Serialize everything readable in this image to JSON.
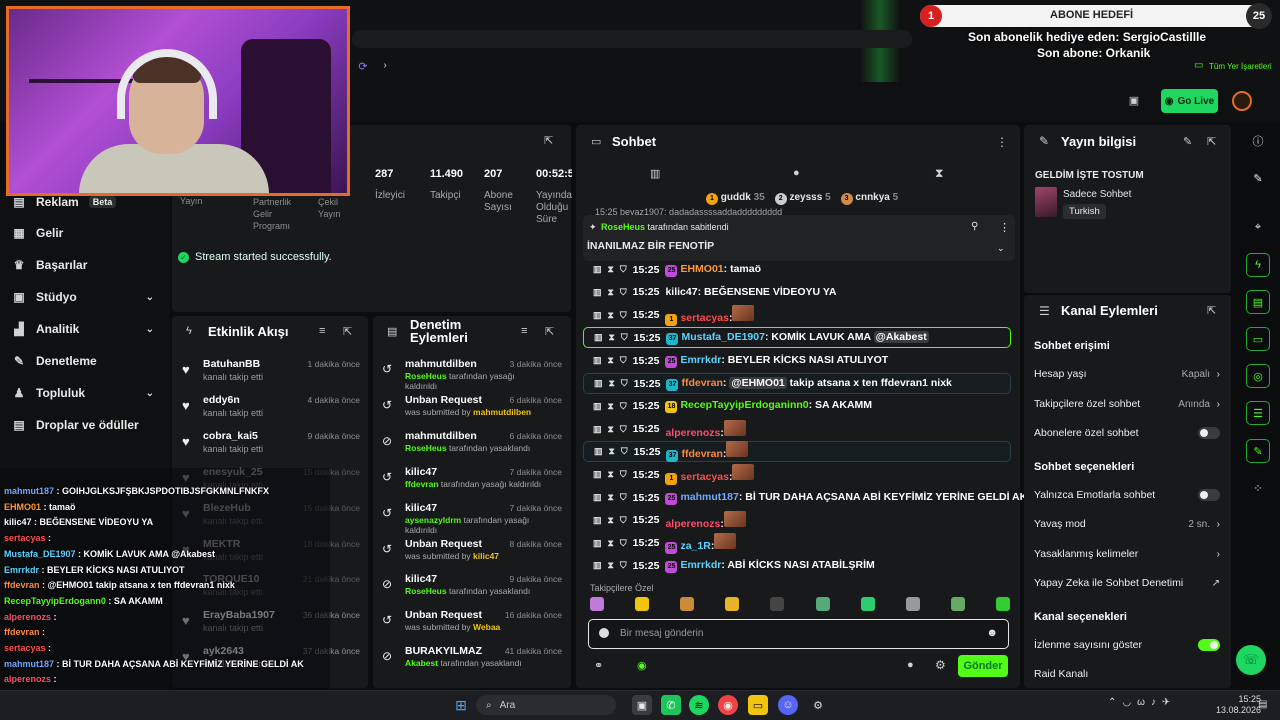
{
  "stats": [
    {
      "value": "287",
      "label": "İzleyici"
    },
    {
      "value": "11.490",
      "label": "Takipçi"
    },
    {
      "value": "207",
      "label": "Abone Sayısı"
    },
    {
      "value": "00:52:5",
      "label": "Yayında Olduğu Süre"
    }
  ],
  "stats_hidden": {
    "partner": "Partnerlik Gelir Programı",
    "yayin": "Yayın",
    "cekil": "Çekil Yayın"
  },
  "success_msg": "Stream started successfully.",
  "sidebar": {
    "reklam": "Reklam",
    "beta": "Beta",
    "items": [
      "Gelir",
      "Başarılar",
      "Stüdyo",
      "Analitik",
      "Denetleme",
      "Topluluk",
      "Droplar ve ödüller"
    ]
  },
  "activity": {
    "title": "Etkinlik Akışı",
    "rows": [
      {
        "name": "BatuhanBB",
        "sub": "kanalı takip etti",
        "time": "1 dakika önce"
      },
      {
        "name": "eddy6n",
        "sub": "kanalı takip etti",
        "time": "4 dakika önce"
      },
      {
        "name": "cobra_kai5",
        "sub": "kanalı takip etti",
        "time": "9 dakika önce"
      },
      {
        "name": "enesyuk_25",
        "sub": "kanalı takip etti",
        "time": "15 dakika önce"
      },
      {
        "name": "BlezeHub",
        "sub": "kanalı takip etti",
        "time": "15 dakika önce"
      },
      {
        "name": "MEKTR",
        "sub": "kanalı takip etti",
        "time": "18 dakika önce"
      },
      {
        "name": "TORQUE10",
        "sub": "kanalı takip etti",
        "time": "21 dakika önce"
      },
      {
        "name": "ErayBaba1907",
        "sub": "kanalı takip etti",
        "time": "36 dakika önce"
      },
      {
        "name": "ayk2643",
        "sub": "kanalı takip etti",
        "time": "37 dakika önce"
      }
    ]
  },
  "moderation": {
    "title": "Denetim Eylemleri",
    "rows": [
      {
        "name": "mahmutdilben",
        "actor": "RoseHeus",
        "sub": " tarafından yasağı kaldırıldı",
        "time": "3 dakika önce"
      },
      {
        "name": "Unban Request",
        "actor": "mahmutdilben",
        "sub": "was submitted by ",
        "time": "6 dakika önce"
      },
      {
        "name": "mahmutdilben",
        "actor": "RoseHeus",
        "sub": " tarafından yasaklandı",
        "time": "6 dakika önce"
      },
      {
        "name": "kilic47",
        "actor": "ffdevran",
        "sub": " tarafından yasağı kaldırıldı",
        "time": "7 dakika önce"
      },
      {
        "name": "kilic47",
        "actor": "aysenazyldrm",
        "sub": " tarafından yasağı kaldırıldı",
        "time": "7 dakika önce"
      },
      {
        "name": "Unban Request",
        "actor": "kilic47",
        "sub": "was submitted by ",
        "time": "8 dakika önce"
      },
      {
        "name": "kilic47",
        "actor": "RoseHeus",
        "sub": " tarafından yasaklandı",
        "time": "9 dakika önce"
      },
      {
        "name": "Unban Request",
        "actor": "Webaa",
        "sub": "was submitted by ",
        "time": "16 dakika önce"
      },
      {
        "name": "BURAKYILMAZ",
        "actor": "Akabest",
        "sub": " tarafından yasaklandı",
        "time": "41 dakika önce"
      }
    ]
  },
  "chat": {
    "title": "Sohbet",
    "top_gifters": [
      {
        "rank": "1",
        "name": "guddk",
        "count": "35"
      },
      {
        "rank": "2",
        "name": "zeysss",
        "count": "5"
      },
      {
        "rank": "3",
        "name": "cnnkya",
        "count": "5"
      }
    ],
    "pinned_by": "RoseHeus",
    "pinned_label": " tarafından sabitlendi",
    "pinned_text": "İNANILMAZ BİR FENOTİP",
    "cut_row": "15:25  beyaz1907: dadadassssaddaddddddddd",
    "messages": [
      {
        "time": "15:25",
        "user": "EHMO01",
        "color": "#ff9a3c",
        "text": ": tamaö",
        "badge": "25",
        "badgecolor": "#c04bd6",
        "style": ""
      },
      {
        "time": "15:25",
        "user": "kilic47",
        "color": "#ffffff",
        "text": ": BEĞENSENE VİDEOYU YA",
        "badge": "",
        "badgecolor": "",
        "style": ""
      },
      {
        "time": "15:25",
        "user": "sertacyas",
        "color": "#ff4c4c",
        "text": ":",
        "badge": "1",
        "badgecolor": "#f1a40f",
        "style": "",
        "emote": true
      },
      {
        "time": "15:25",
        "user": "Mustafa_DE1907",
        "color": "#5fd3ff",
        "text": ": KOMİK LAVUK AMA ",
        "mention": "@Akabest",
        "badge": "37",
        "badgecolor": "#1fb5c9",
        "style": "hl"
      },
      {
        "time": "15:25",
        "user": "Emrrkdr",
        "color": "#5fd3ff",
        "text": ": BEYLER KİCKS NASI ATULIYOT",
        "badge": "25",
        "badgecolor": "#c04bd6",
        "style": ""
      },
      {
        "time": "15:25",
        "user": "ffdevran",
        "color": "#ff8a3c",
        "text": ": ",
        "mention": "@EHMO01",
        "after": " takip atsana x ten ffdevran1 nixk",
        "badge": "37",
        "badgecolor": "#1fb5c9",
        "style": "hl2"
      },
      {
        "time": "15:25",
        "user": "RecepTayyipErdoganinn0",
        "color": "#53fc18",
        "text": ": SA AKAMM",
        "badge": "18",
        "badgecolor": "#f1c40f",
        "style": ""
      },
      {
        "time": "15:25",
        "user": "alperenozs",
        "color": "#ff4c6a",
        "text": ":",
        "badge": "",
        "badgecolor": "",
        "style": "",
        "emote": true
      },
      {
        "time": "15:25",
        "user": "ffdevran",
        "color": "#ff8a3c",
        "text": ":",
        "badge": "37",
        "badgecolor": "#1fb5c9",
        "style": "hl2",
        "emote": true
      },
      {
        "time": "15:25",
        "user": "sertacyas",
        "color": "#ff4c4c",
        "text": ":",
        "badge": "1",
        "badgecolor": "#f1a40f",
        "style": "",
        "emote": true
      },
      {
        "time": "15:25",
        "user": "mahmut187",
        "color": "#6fa8ff",
        "text": ": Bİ TUR DAHA AÇSANA ABİ KEYFİMİZ YERİNE GELDİ AK",
        "badge": "25",
        "badgecolor": "#c04bd6",
        "style": ""
      },
      {
        "time": "15:25",
        "user": "alperenozs",
        "color": "#ff4c6a",
        "text": ":",
        "badge": "",
        "badgecolor": "",
        "style": "",
        "emote": true
      },
      {
        "time": "15:25",
        "user": "za_1R",
        "color": "#5fd3ff",
        "text": ":",
        "badge": "25",
        "badgecolor": "#c04bd6",
        "style": "",
        "emote": true
      },
      {
        "time": "15:25",
        "user": "Emrrkdr",
        "color": "#5fd3ff",
        "text": ": ABİ KİCKS NASI ATABİLŞRİM",
        "badge": "25",
        "badgecolor": "#c04bd6",
        "style": ""
      }
    ],
    "followers_only": "Takipçilere Özel",
    "input_placeholder": "Bir mesaj gönderin",
    "send": "Gönder"
  },
  "info": {
    "title": "Yayın bilgisi",
    "stream_title": "GELDİM İŞTE TOSTUM",
    "category": "Sadece Sohbet",
    "tag": "Turkish"
  },
  "channel": {
    "title": "Kanal Eylemleri",
    "chat_access": "Sohbet erişimi",
    "account_age": "Hesap yaşı",
    "account_age_v": "Kapalı",
    "followers_only": "Takipçilere özel sohbet",
    "followers_only_v": "Anında",
    "subs_only": "Abonelere özel sohbet",
    "chat_options": "Sohbet seçenekleri",
    "emote_only": "Yalnızca Emotlarla sohbet",
    "slow": "Yavaş mod",
    "slow_v": "2 sn.",
    "banned_words": "Yasaklanmış kelimeler",
    "ai_mod": "Yapay Zeka ile Sohbet Denetimi",
    "channel_options": "Kanal seçenekleri",
    "viewcount": "İzlenme sayısını göster",
    "raid": "Raid Kanalı"
  },
  "overlay": {
    "goal_num": "1",
    "goal": "ABONE HEDEFİ",
    "goal_total": "25",
    "last_gift": "Son abonelik hediye eden: SergioCastillle",
    "last_sub": "Son abone: Orkanik",
    "bookmarks": "Tüm Yer İşaretleri",
    "golive": "Go Live"
  },
  "overlay_chat": [
    {
      "user": "mahmut187",
      "color": "#6fa8ff",
      "text": " : GOIHJGLKSJFŞBKJSPDOTIBJSFGKMNLFNKFX"
    },
    {
      "user": "EHMO01",
      "color": "#ff9a3c",
      "text": " : tamaö"
    },
    {
      "user": "kilic47",
      "color": "#ffffff",
      "text": " : BEĞENSENE VİDEOYU YA"
    },
    {
      "user": "sertacyas",
      "color": "#ff4c4c",
      "text": " :"
    },
    {
      "user": "Mustafa_DE1907",
      "color": "#5fd3ff",
      "text": " : KOMİK LAVUK AMA @Akabest"
    },
    {
      "user": "Emrrkdr",
      "color": "#5fd3ff",
      "text": " : BEYLER KİCKS NASI ATULIYOT"
    },
    {
      "user": "ffdevran",
      "color": "#ff8a3c",
      "text": " : @EHMO01 takip atsana x ten ffdevran1 nixk"
    },
    {
      "user": "RecepTayyipErdogann0",
      "color": "#53fc18",
      "text": " : SA AKAMM"
    },
    {
      "user": "alperenozs",
      "color": "#ff4c6a",
      "text": " :"
    },
    {
      "user": "ffdevran",
      "color": "#ff8a3c",
      "text": " :"
    },
    {
      "user": "sertacyas",
      "color": "#ff4c4c",
      "text": " :"
    },
    {
      "user": "mahmut187",
      "color": "#6fa8ff",
      "text": " : Bİ TUR DAHA AÇSANA ABİ KEYFİMİZ YERİNE GELDİ AK"
    },
    {
      "user": "alperenozs",
      "color": "#ff4c6a",
      "text": " :"
    },
    {
      "user": "za_1R",
      "color": "#5fd3ff",
      "text": " :"
    },
    {
      "user": "",
      "color": "#ffffff",
      "text": "Bİ KİCKS NASI ATABİLŞRİM"
    }
  ],
  "taskbar": {
    "search": "Ara",
    "time": "15:25",
    "date": "13.08.2026"
  },
  "colors": {
    "accent": "#53fc18",
    "panel": "#18191b",
    "bg": "#0b0c0d"
  }
}
